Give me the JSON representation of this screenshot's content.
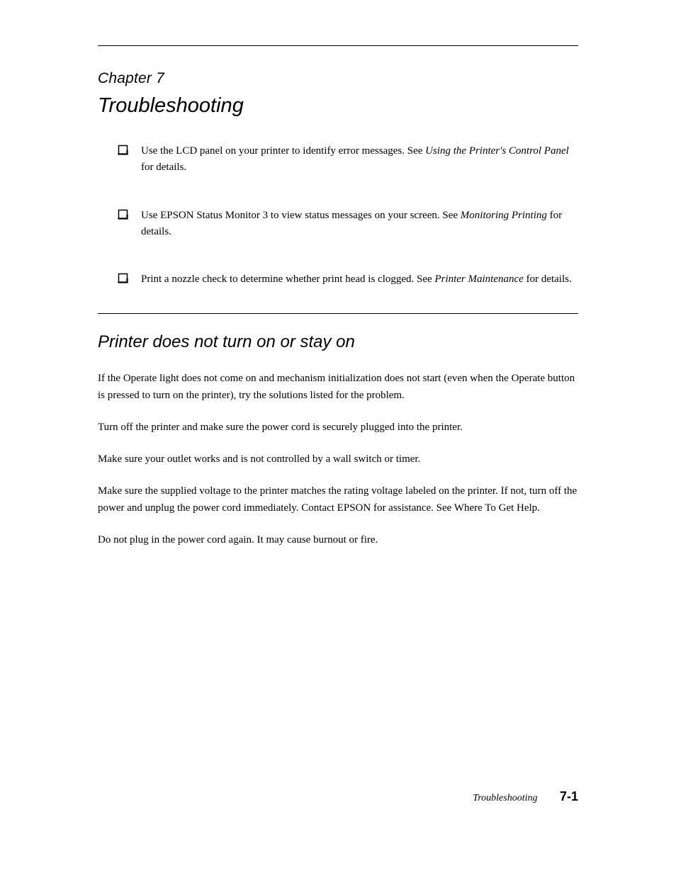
{
  "chapter": {
    "label": "Chapter 7",
    "title": "Troubleshooting"
  },
  "bullets": [
    {
      "text_before": "Use the LCD panel on your printer to identify error messages. See ",
      "ref": "Using the Printer's Control Panel",
      "text_after": " for details."
    },
    {
      "text_before": "Use EPSON Status Monitor 3 to view status messages on your screen. See ",
      "ref": "Monitoring Printing",
      "text_after": " for details."
    },
    {
      "text_before": "Print a nozzle check to determine whether print head is clogged. See ",
      "ref": "Printer Maintenance",
      "text_after": " for details."
    }
  ],
  "section": {
    "title": "Printer does not turn on or stay on",
    "paragraphs": [
      "If the Operate light does not come on and mechanism initialization does not start (even when the Operate button is pressed to turn on the printer), try the solutions listed for the problem.",
      "Turn off the printer and make sure the power cord is securely plugged into the printer.",
      "Make sure your outlet works and is not controlled by a wall switch or timer.",
      "Make sure the supplied voltage to the printer matches the rating voltage labeled on the printer. If not, turn off the power and unplug the power cord immediately. Contact EPSON for assistance. See Where To Get Help.",
      "Do not plug in the power cord again. It may cause burnout or fire."
    ]
  },
  "footer": {
    "label": "Troubleshooting",
    "page": "7-1"
  }
}
